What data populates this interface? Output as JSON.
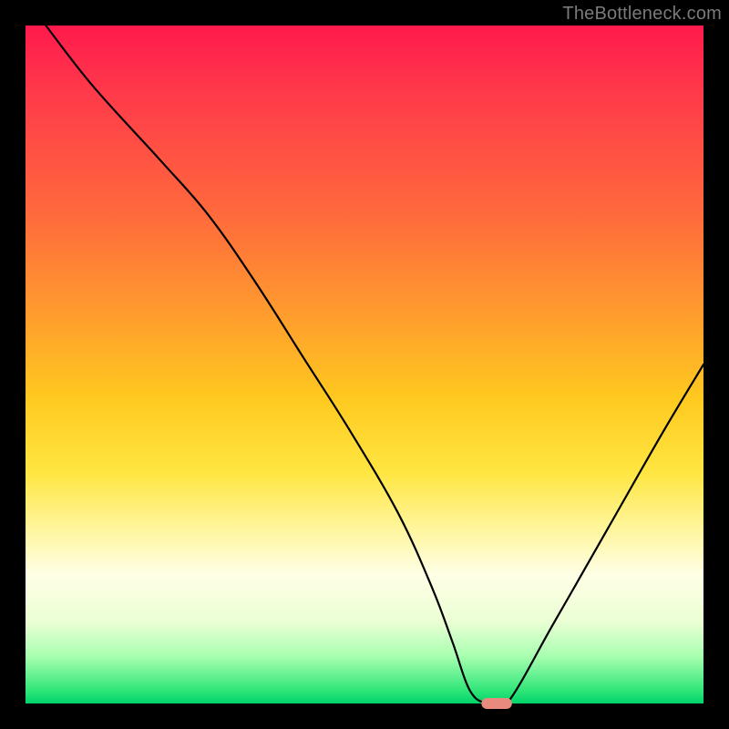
{
  "watermark": "TheBottleneck.com",
  "colors": {
    "curve": "#000000",
    "marker": "#e98a7f",
    "gradient_top": "#ff1a4d",
    "gradient_bottom": "#00d46a",
    "page_bg": "#000000"
  },
  "chart_data": {
    "type": "line",
    "title": "",
    "xlabel": "",
    "ylabel": "",
    "xlim": [
      0,
      100
    ],
    "ylim": [
      0,
      100
    ],
    "grid": false,
    "legend": null,
    "series": [
      {
        "name": "bottleneck-curve",
        "x": [
          3,
          10,
          20,
          27,
          34,
          41,
          48,
          55,
          60,
          63,
          65.5,
          68,
          71,
          78,
          86,
          94,
          100
        ],
        "y": [
          100,
          91,
          80,
          72,
          62,
          51,
          40,
          28,
          17,
          9,
          2,
          0,
          0,
          12,
          26,
          40,
          50
        ]
      }
    ],
    "annotations": [
      {
        "name": "optimal-marker",
        "shape": "capsule",
        "x_center": 69.5,
        "y_center": 0,
        "width": 4.5,
        "height": 1.6
      }
    ]
  }
}
